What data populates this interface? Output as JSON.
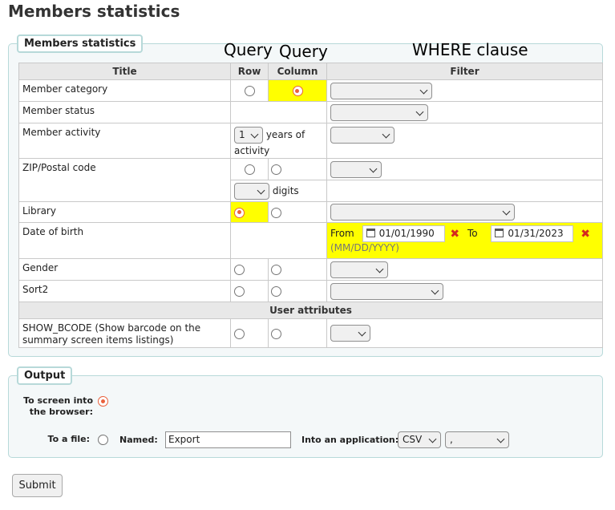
{
  "page_title": "Members statistics",
  "fieldset_stats_legend": "Members statistics",
  "annotations": {
    "row": "Query",
    "column": "Query",
    "filter": "WHERE clause"
  },
  "table": {
    "headers": {
      "title": "Title",
      "row": "Row",
      "column": "Column",
      "filter": "Filter"
    },
    "rows": {
      "member_category": {
        "label": "Member category",
        "row_checked": false,
        "col_checked": true
      },
      "member_status": {
        "label": "Member status"
      },
      "member_activity": {
        "label": "Member activity",
        "select_value": "1",
        "suffix": "years of activity"
      },
      "zip": {
        "label": "ZIP/Postal code",
        "digits_label": "digits"
      },
      "library": {
        "label": "Library",
        "row_checked": true,
        "col_checked": false
      },
      "dob": {
        "label": "Date of birth",
        "from_label": "From",
        "from_value": "01/01/1990",
        "to_label": "To",
        "to_value": "01/31/2023",
        "format_hint": "(MM/DD/YYYY)"
      },
      "gender": {
        "label": "Gender"
      },
      "sort2": {
        "label": "Sort2"
      },
      "user_attributes_header": "User attributes",
      "show_bcode": {
        "label": "SHOW_BCODE (Show barcode on the summary screen items listings)"
      }
    }
  },
  "output": {
    "legend": "Output",
    "to_screen_label": "To screen into the browser:",
    "to_screen_checked": true,
    "to_file_label": "To a file:",
    "to_file_checked": false,
    "named_label": "Named:",
    "named_value": "Export",
    "application_label": "Into an application:",
    "format_value": "CSV",
    "delimiter_value": ","
  },
  "submit_label": "Submit",
  "colors": {
    "highlight": "#ffff00",
    "radio_accent": "#e9613d",
    "remove_x": "#d42b1e",
    "fieldset_border": "#b7d9d9"
  }
}
